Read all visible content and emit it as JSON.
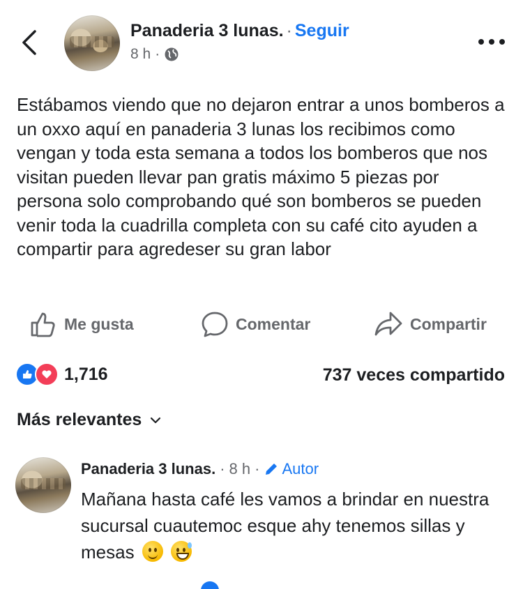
{
  "header": {
    "page_name": "Panaderia 3 lunas.",
    "separator": "·",
    "follow_label": "Seguir",
    "time": "8 h",
    "meta_sep": "·",
    "privacy_icon": "globe-icon"
  },
  "post": {
    "text": "Estábamos viendo que no dejaron entrar a unos bomberos a un oxxo aquí en panaderia 3 lunas los recibimos como vengan y toda esta semana a todos los bomberos que nos visitan pueden llevar pan gratis máximo 5 piezas por persona solo comprobando qué son bomberos se pueden venir toda la cuadrilla completa con su café cito ayuden a compartir para agredeser su gran labor"
  },
  "actions": {
    "like_label": "Me gusta",
    "comment_label": "Comentar",
    "share_label": "Compartir"
  },
  "stats": {
    "reaction_count": "1,716",
    "shares": "737 veces compartido"
  },
  "sort": {
    "label": "Más relevantes"
  },
  "comment": {
    "author": "Panaderia 3 lunas.",
    "sep1": "·",
    "time": "8 h",
    "sep2": "·",
    "badge": "Autor",
    "text": "Mañana hasta café les vamos a brindar en nuestra sucursal cuautemoc esque ahy tenemos sillas y mesas"
  },
  "colors": {
    "accent": "#1877f2",
    "text": "#1c1e21",
    "secondary": "#65676b",
    "love": "#f33e58"
  }
}
